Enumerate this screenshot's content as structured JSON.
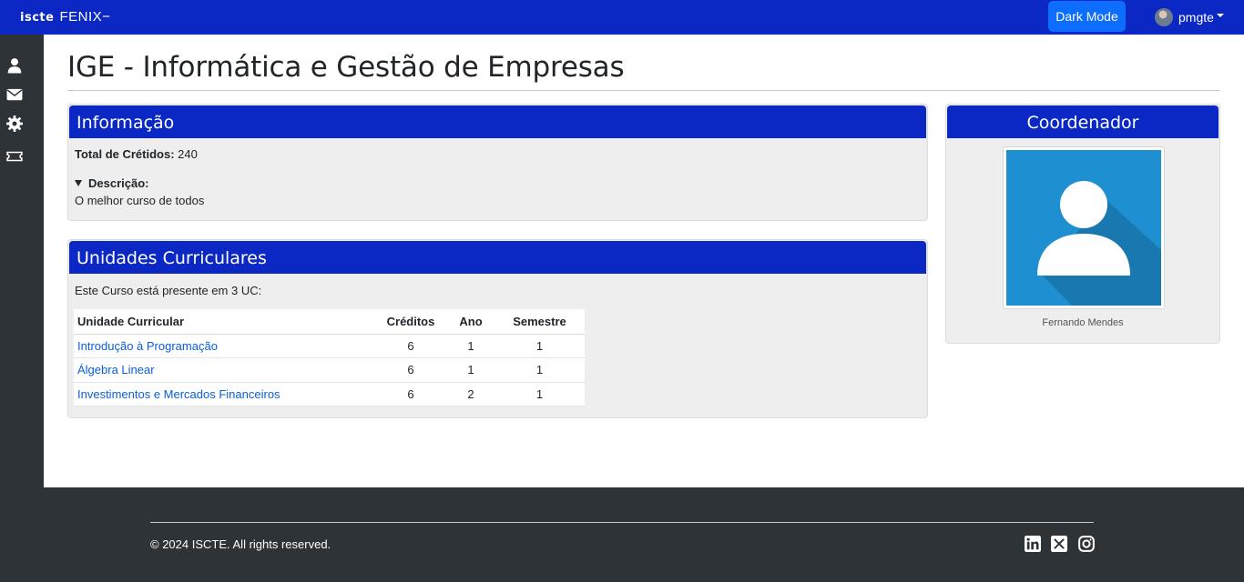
{
  "navbar": {
    "brand_logo": "iscte",
    "brand_name": "FENIX",
    "brand_suffix": "−",
    "dark_mode_label": "Dark Mode",
    "username": "pmgte"
  },
  "sidebar": {
    "icons": [
      "user-icon",
      "envelope-icon",
      "gear-icon",
      "ticket-icon"
    ]
  },
  "page": {
    "title": "IGE - Informática e Gestão de Empresas"
  },
  "info_card": {
    "header": "Informação",
    "credits_label": "Total de Crétidos:",
    "credits_value": "240",
    "description_label": "Descrição:",
    "description_text": "O melhor curso de todos"
  },
  "uc_card": {
    "header": "Unidades Curriculares",
    "intro": "Este Curso está presente em 3 UC:",
    "columns": [
      "Unidade Curricular",
      "Créditos",
      "Ano",
      "Semestre"
    ],
    "rows": [
      {
        "name": "Introdução à Programação",
        "credits": "6",
        "year": "1",
        "semester": "1"
      },
      {
        "name": "Álgebra Linear",
        "credits": "6",
        "year": "1",
        "semester": "1"
      },
      {
        "name": "Investimentos e Mercados Financeiros",
        "credits": "6",
        "year": "2",
        "semester": "1"
      }
    ]
  },
  "coord_card": {
    "header": "Coordenador",
    "name": "Fernando Mendes"
  },
  "footer": {
    "copyright": "© 2024 ISCTE. All rights reserved.",
    "social": [
      "linkedin-icon",
      "x-icon",
      "instagram-icon"
    ]
  },
  "colors": {
    "primary": "#0b28c5",
    "button": "#0d6efd",
    "sidebar": "#2e3338",
    "link": "#0b5ed7",
    "avatar_bg": "#1e8fd0"
  }
}
